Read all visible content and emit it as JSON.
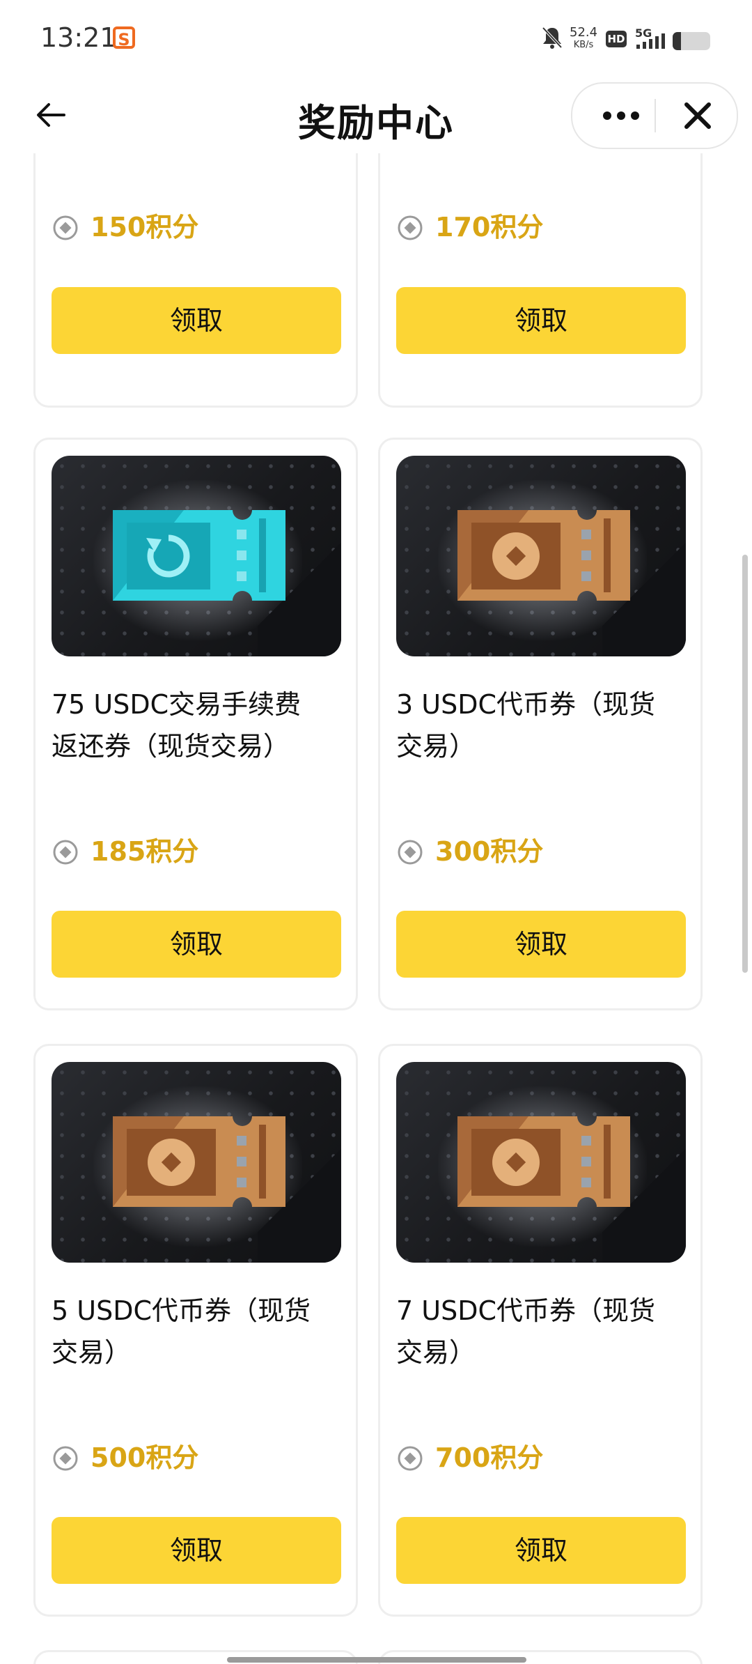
{
  "status_bar": {
    "time": "13:21",
    "app_badge": "S",
    "net_speed_value": "52.4",
    "net_speed_unit": "KB/s",
    "hd_label": "HD",
    "network": "5G",
    "battery_percent": 20,
    "icons": [
      "mute-bell-icon",
      "signal-icon",
      "battery-icon"
    ]
  },
  "header": {
    "title": "奖励中心",
    "back_icon": "arrow-left-icon",
    "more_icon": "more-dots-icon",
    "close_icon": "close-icon"
  },
  "colors": {
    "accent_button": "#fcd535",
    "points_text": "#d9a515",
    "card_border": "#eeeeee",
    "cyan_ticket": "#2fd4e0",
    "bronze_ticket": "#c98c52"
  },
  "cards": [
    {
      "title": "",
      "points": "150积分",
      "button": "领取",
      "icon": "points-coin-icon"
    },
    {
      "title": "",
      "points": "170积分",
      "button": "领取",
      "icon": "points-coin-icon"
    },
    {
      "title_line1": "75 USDC交易手续费",
      "title_line2": "返还券（现货交易）",
      "points": "185积分",
      "button": "领取",
      "image": "cyan-rebate-ticket-icon"
    },
    {
      "title_line1": "3 USDC代币券（现货",
      "title_line2": "交易）",
      "points": "300积分",
      "button": "领取",
      "image": "bronze-token-ticket-icon"
    },
    {
      "title_line1": "5 USDC代币券（现货",
      "title_line2": "交易）",
      "points": "500积分",
      "button": "领取",
      "image": "bronze-token-ticket-icon"
    },
    {
      "title_line1": "7 USDC代币券（现货",
      "title_line2": "交易）",
      "points": "700积分",
      "button": "领取",
      "image": "bronze-token-ticket-icon"
    }
  ]
}
